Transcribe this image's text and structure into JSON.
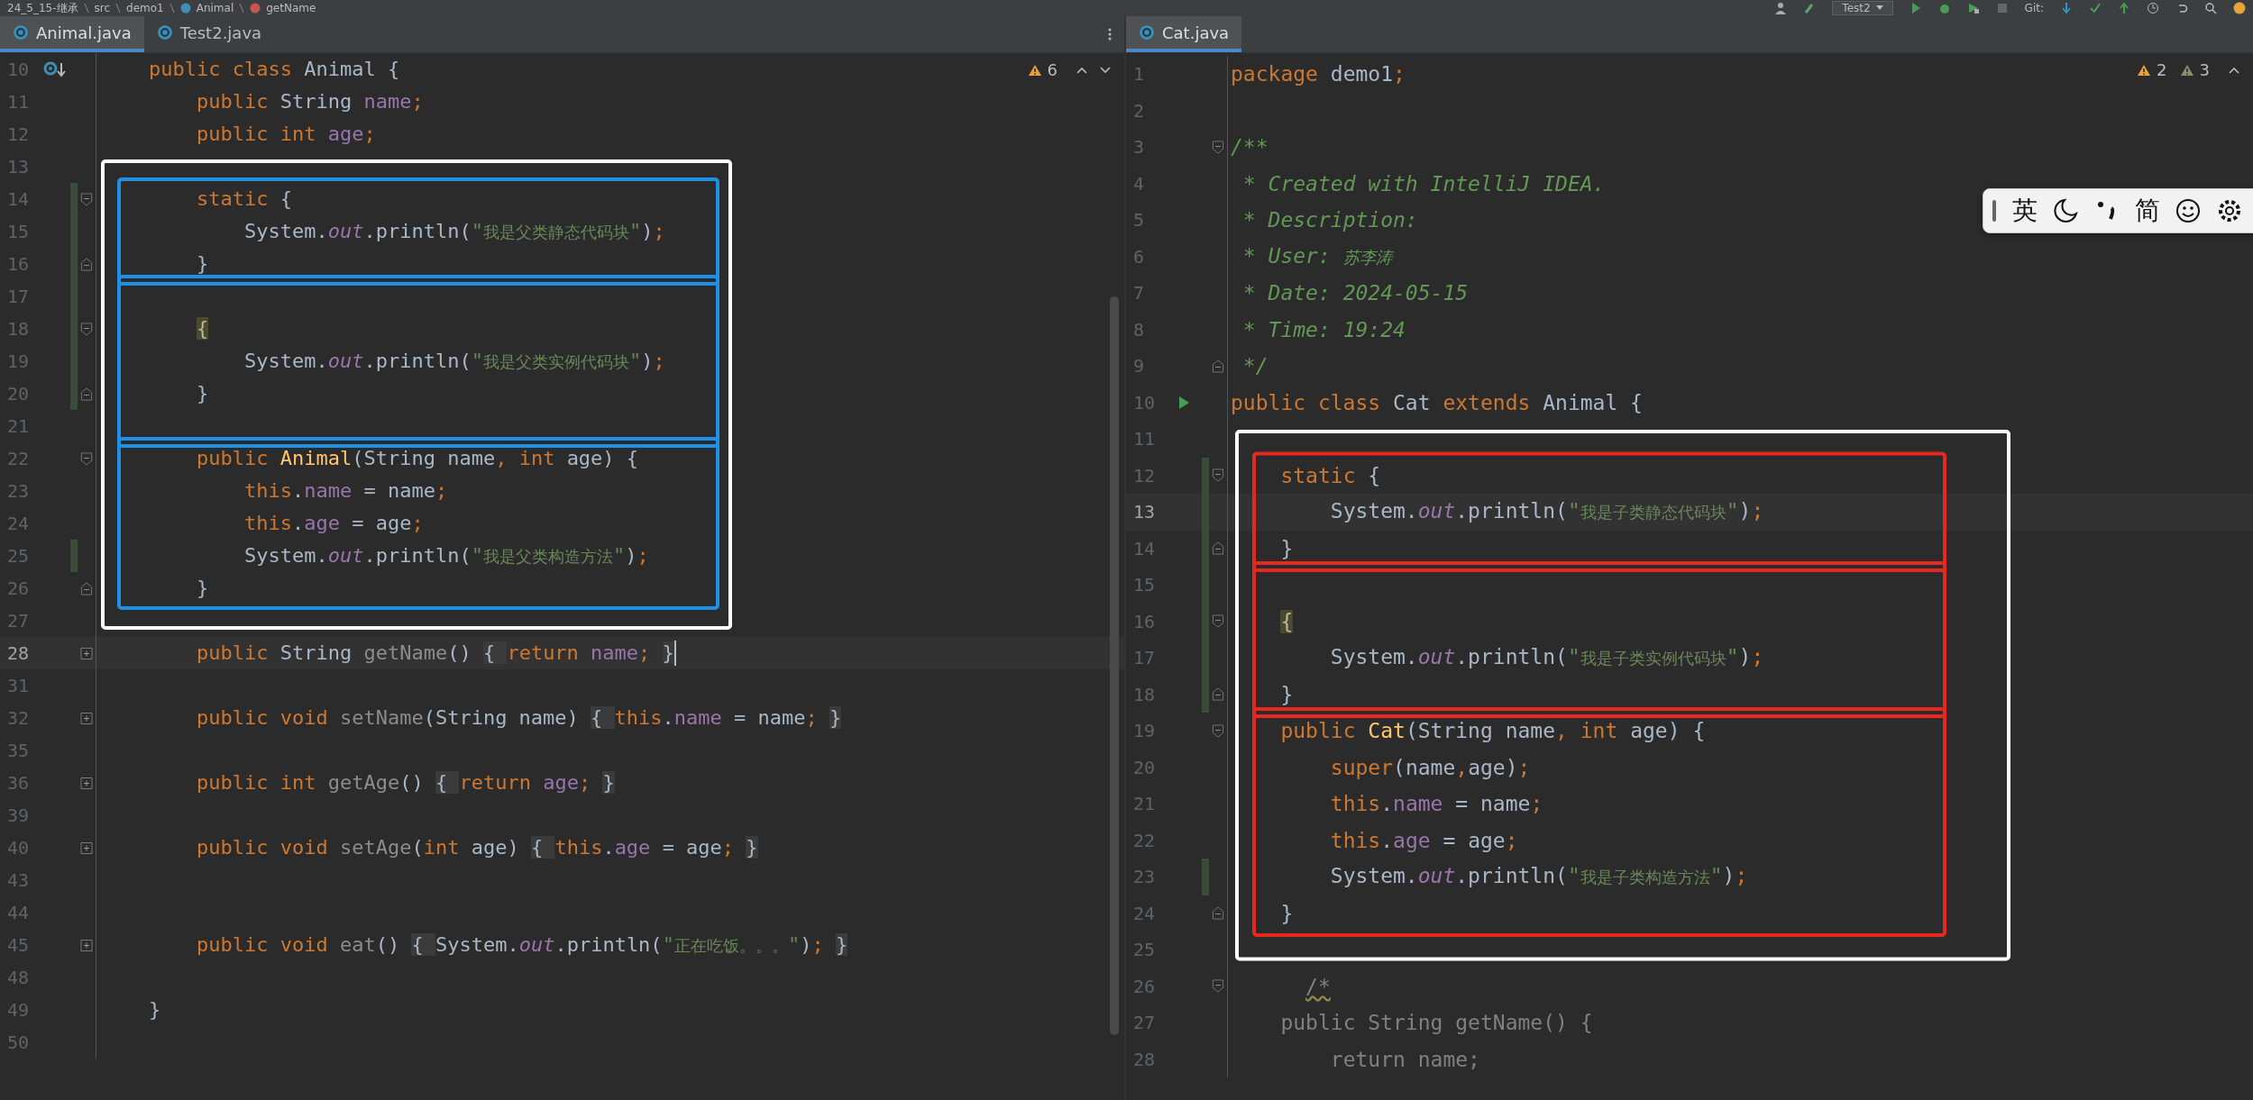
{
  "breadcrumb": [
    {
      "label": "24_5_15-继承",
      "kind": "folder"
    },
    {
      "label": "src",
      "kind": "folder"
    },
    {
      "label": "demo1",
      "kind": "folder"
    },
    {
      "label": "Animal",
      "kind": "class"
    },
    {
      "label": "getName",
      "kind": "method"
    }
  ],
  "toolbar": {
    "run_config": "Test2",
    "vcs_label": "Git:"
  },
  "panes": [
    {
      "tabs": [
        {
          "label": "Animal.java",
          "selected": true
        },
        {
          "label": "Test2.java",
          "selected": false
        }
      ],
      "inspections": [
        {
          "kind": "warning",
          "count": "6"
        }
      ],
      "navigation": [
        {
          "kind": "up"
        },
        {
          "kind": "down"
        }
      ],
      "lines": [
        {
          "number": "10",
          "kind": "override",
          "changed": false,
          "current": false,
          "tokens": [
            {
              "text": "public class ",
              "kind": "kw"
            },
            {
              "text": "Animal {",
              "kind": "plain"
            }
          ]
        },
        {
          "number": "11",
          "kind": "plain",
          "changed": false,
          "current": false,
          "tokens": [
            {
              "text": "    public ",
              "kind": "kw"
            },
            {
              "text": "String ",
              "kind": "plain"
            },
            {
              "text": "name",
              "kind": "field"
            },
            {
              "text": ";",
              "kind": "kw"
            }
          ]
        },
        {
          "number": "12",
          "kind": "plain",
          "changed": false,
          "current": false,
          "tokens": [
            {
              "text": "    public int ",
              "kind": "kw"
            },
            {
              "text": "age",
              "kind": "field"
            },
            {
              "text": ";",
              "kind": "kw"
            }
          ]
        },
        {
          "kind": "frame",
          "color": "#ffffff",
          "children": [
            {
              "number": "13",
              "kind": "plain",
              "changed": false,
              "current": false
            },
            {
              "kind": "frame",
              "color": "#1e90e8",
              "children": [
                {
                  "number": "14",
                  "kind": "fold_start",
                  "changed": true,
                  "current": false,
                  "tokens": [
                    {
                      "text": "    static ",
                      "kind": "kw"
                    },
                    {
                      "text": "{",
                      "kind": "plain"
                    }
                  ]
                },
                {
                  "number": "15",
                  "kind": "plain",
                  "changed": true,
                  "current": false,
                  "tokens": [
                    {
                      "text": "        System.",
                      "kind": "plain"
                    },
                    {
                      "text": "out",
                      "kind": "static"
                    },
                    {
                      "text": ".println(",
                      "kind": "plain"
                    },
                    {
                      "text": "\"我是父类静态代码块\"",
                      "kind": "str"
                    },
                    {
                      "text": ")",
                      "kind": "plain"
                    },
                    {
                      "text": ";",
                      "kind": "kw"
                    }
                  ]
                },
                {
                  "number": "16",
                  "kind": "fold_end",
                  "changed": true,
                  "current": false,
                  "tokens": [
                    {
                      "text": "    }",
                      "kind": "plain"
                    }
                  ]
                }
              ]
            },
            {
              "kind": "frame",
              "color": "#1e90e8",
              "children": [
                {
                  "number": "17",
                  "kind": "plain",
                  "changed": true,
                  "current": false
                },
                {
                  "number": "18",
                  "kind": "fold_start",
                  "changed": true,
                  "current": false,
                  "tokens": [
                    {
                      "text": "    {",
                      "kind": "brace"
                    }
                  ]
                },
                {
                  "number": "19",
                  "kind": "plain",
                  "changed": true,
                  "current": false,
                  "tokens": [
                    {
                      "text": "        System.",
                      "kind": "plain"
                    },
                    {
                      "text": "out",
                      "kind": "static"
                    },
                    {
                      "text": ".println(",
                      "kind": "plain"
                    },
                    {
                      "text": "\"我是父类实例代码块\"",
                      "kind": "str"
                    },
                    {
                      "text": ")",
                      "kind": "plain"
                    },
                    {
                      "text": ";",
                      "kind": "kw"
                    }
                  ]
                },
                {
                  "number": "20",
                  "kind": "fold_end",
                  "changed": true,
                  "current": false,
                  "tokens": [
                    {
                      "text": "    }",
                      "kind": "plain"
                    }
                  ]
                },
                {
                  "number": "21",
                  "kind": "plain",
                  "changed": false,
                  "current": false
                }
              ]
            },
            {
              "kind": "frame",
              "color": "#1e90e8",
              "children": [
                {
                  "number": "22",
                  "kind": "fold_start",
                  "changed": false,
                  "current": false,
                  "tokens": [
                    {
                      "text": "    public ",
                      "kind": "kw"
                    },
                    {
                      "text": "Animal",
                      "kind": "decl"
                    },
                    {
                      "text": "(String name",
                      "kind": "plain"
                    },
                    {
                      "text": ", ",
                      "kind": "kw"
                    },
                    {
                      "text": "int ",
                      "kind": "kw"
                    },
                    {
                      "text": "age) {",
                      "kind": "plain"
                    }
                  ]
                },
                {
                  "number": "23",
                  "kind": "plain",
                  "changed": false,
                  "current": false,
                  "tokens": [
                    {
                      "text": "        this",
                      "kind": "kw"
                    },
                    {
                      "text": ".",
                      "kind": "plain"
                    },
                    {
                      "text": "name",
                      "kind": "field"
                    },
                    {
                      "text": " = name",
                      "kind": "plain"
                    },
                    {
                      "text": ";",
                      "kind": "kw"
                    }
                  ]
                },
                {
                  "number": "24",
                  "kind": "plain",
                  "changed": false,
                  "current": false,
                  "tokens": [
                    {
                      "text": "        this",
                      "kind": "kw"
                    },
                    {
                      "text": ".",
                      "kind": "plain"
                    },
                    {
                      "text": "age",
                      "kind": "field"
                    },
                    {
                      "text": " = age",
                      "kind": "plain"
                    },
                    {
                      "text": ";",
                      "kind": "kw"
                    }
                  ]
                },
                {
                  "number": "25",
                  "kind": "plain",
                  "changed": true,
                  "current": false,
                  "tokens": [
                    {
                      "text": "        System.",
                      "kind": "plain"
                    },
                    {
                      "text": "out",
                      "kind": "static"
                    },
                    {
                      "text": ".println(",
                      "kind": "plain"
                    },
                    {
                      "text": "\"我是父类构造方法\"",
                      "kind": "str"
                    },
                    {
                      "text": ")",
                      "kind": "plain"
                    },
                    {
                      "text": ";",
                      "kind": "kw"
                    }
                  ]
                },
                {
                  "number": "26",
                  "kind": "fold_end",
                  "changed": false,
                  "current": false,
                  "tokens": [
                    {
                      "text": "    }",
                      "kind": "plain"
                    }
                  ]
                }
              ]
            },
            {
              "number": "27",
              "kind": "plain",
              "changed": false,
              "current": false
            }
          ]
        },
        {
          "number": "28",
          "kind": "folded",
          "changed": false,
          "current": true,
          "tokens": [
            {
              "text": "    public ",
              "kind": "kw"
            },
            {
              "text": "String ",
              "kind": "plain"
            },
            {
              "text": "getName",
              "kind": "dim"
            },
            {
              "text": "() ",
              "kind": "plain"
            },
            {
              "text": "{ ",
              "kind": "fold"
            },
            {
              "text": "return ",
              "kind": "kw"
            },
            {
              "text": "name",
              "kind": "field"
            },
            {
              "text": ";",
              "kind": "kw"
            },
            {
              "text": " }",
              "kind": "fold"
            }
          ]
        },
        {
          "number": "31",
          "kind": "plain",
          "changed": false,
          "current": false
        },
        {
          "number": "32",
          "kind": "folded",
          "changed": false,
          "current": false,
          "tokens": [
            {
              "text": "    public void ",
              "kind": "kw"
            },
            {
              "text": "setName",
              "kind": "dim"
            },
            {
              "text": "(String name) ",
              "kind": "plain"
            },
            {
              "text": "{ ",
              "kind": "fold"
            },
            {
              "text": "this",
              "kind": "kw"
            },
            {
              "text": ".",
              "kind": "plain"
            },
            {
              "text": "name",
              "kind": "field"
            },
            {
              "text": " = name",
              "kind": "plain"
            },
            {
              "text": ";",
              "kind": "kw"
            },
            {
              "text": " }",
              "kind": "fold"
            }
          ]
        },
        {
          "number": "35",
          "kind": "plain",
          "changed": false,
          "current": false
        },
        {
          "number": "36",
          "kind": "folded",
          "changed": false,
          "current": false,
          "tokens": [
            {
              "text": "    public int ",
              "kind": "kw"
            },
            {
              "text": "getAge",
              "kind": "dim"
            },
            {
              "text": "() ",
              "kind": "plain"
            },
            {
              "text": "{ ",
              "kind": "fold"
            },
            {
              "text": "return ",
              "kind": "kw"
            },
            {
              "text": "age",
              "kind": "field"
            },
            {
              "text": ";",
              "kind": "kw"
            },
            {
              "text": " }",
              "kind": "fold"
            }
          ]
        },
        {
          "number": "39",
          "kind": "plain",
          "changed": false,
          "current": false
        },
        {
          "number": "40",
          "kind": "folded",
          "changed": false,
          "current": false,
          "tokens": [
            {
              "text": "    public void ",
              "kind": "kw"
            },
            {
              "text": "setAge",
              "kind": "dim"
            },
            {
              "text": "(",
              "kind": "plain"
            },
            {
              "text": "int ",
              "kind": "kw"
            },
            {
              "text": "age) ",
              "kind": "plain"
            },
            {
              "text": "{ ",
              "kind": "fold"
            },
            {
              "text": "this",
              "kind": "kw"
            },
            {
              "text": ".",
              "kind": "plain"
            },
            {
              "text": "age",
              "kind": "field"
            },
            {
              "text": " = age",
              "kind": "plain"
            },
            {
              "text": ";",
              "kind": "kw"
            },
            {
              "text": " }",
              "kind": "fold"
            }
          ]
        },
        {
          "number": "43",
          "kind": "plain",
          "changed": false,
          "current": false
        },
        {
          "number": "44",
          "kind": "plain",
          "changed": false,
          "current": false
        },
        {
          "number": "45",
          "kind": "folded",
          "changed": false,
          "current": false,
          "tokens": [
            {
              "text": "    public void ",
              "kind": "kw"
            },
            {
              "text": "eat",
              "kind": "dim"
            },
            {
              "text": "() ",
              "kind": "plain"
            },
            {
              "text": "{ ",
              "kind": "fold"
            },
            {
              "text": "System.",
              "kind": "plain"
            },
            {
              "text": "out",
              "kind": "static"
            },
            {
              "text": ".println(",
              "kind": "plain"
            },
            {
              "text": "\"正在吃饭。。。\"",
              "kind": "str"
            },
            {
              "text": ")",
              "kind": "plain"
            },
            {
              "text": ";",
              "kind": "kw"
            },
            {
              "text": " }",
              "kind": "fold"
            }
          ]
        },
        {
          "number": "48",
          "kind": "plain",
          "changed": false,
          "current": false
        },
        {
          "number": "49",
          "kind": "plain",
          "changed": false,
          "current": false,
          "tokens": [
            {
              "text": "}",
              "kind": "plain"
            }
          ]
        },
        {
          "number": "50",
          "kind": "plain",
          "changed": false,
          "current": false
        }
      ]
    },
    {
      "tabs": [
        {
          "label": "Cat.java",
          "selected": true
        }
      ],
      "inspections": [
        {
          "kind": "warning",
          "count": "2"
        },
        {
          "kind": "weak",
          "count": "3"
        }
      ],
      "navigation": [
        {
          "kind": "up"
        }
      ],
      "lines": [
        {
          "number": "1",
          "kind": "plain",
          "changed": false,
          "current": false,
          "tokens": [
            {
              "text": "package ",
              "kind": "kw"
            },
            {
              "text": "demo1",
              "kind": "plain"
            },
            {
              "text": ";",
              "kind": "kw"
            }
          ]
        },
        {
          "number": "2",
          "kind": "plain",
          "changed": false,
          "current": false
        },
        {
          "number": "3",
          "kind": "fold_start",
          "changed": false,
          "current": false,
          "tokens": [
            {
              "text": "/**",
              "kind": "doc"
            }
          ]
        },
        {
          "number": "4",
          "kind": "plain",
          "changed": false,
          "current": false,
          "tokens": [
            {
              "text": " * Created with IntelliJ IDEA.",
              "kind": "doc"
            }
          ]
        },
        {
          "number": "5",
          "kind": "plain",
          "changed": false,
          "current": false,
          "tokens": [
            {
              "text": " * Description:",
              "kind": "doc"
            }
          ]
        },
        {
          "number": "6",
          "kind": "plain",
          "changed": false,
          "current": false,
          "tokens": [
            {
              "text": " * User: 苏李涛",
              "kind": "doc"
            }
          ]
        },
        {
          "number": "7",
          "kind": "plain",
          "changed": false,
          "current": false,
          "tokens": [
            {
              "text": " * Date: 2024-05-15",
              "kind": "doc"
            }
          ]
        },
        {
          "number": "8",
          "kind": "plain",
          "changed": false,
          "current": false,
          "tokens": [
            {
              "text": " * Time: 19:24",
              "kind": "doc"
            }
          ]
        },
        {
          "number": "9",
          "kind": "fold_end",
          "changed": false,
          "current": false,
          "tokens": [
            {
              "text": " */",
              "kind": "doc"
            }
          ]
        },
        {
          "number": "10",
          "kind": "run",
          "changed": false,
          "current": false,
          "tokens": [
            {
              "text": "public class ",
              "kind": "kw"
            },
            {
              "text": "Cat ",
              "kind": "plain"
            },
            {
              "text": "extends ",
              "kind": "kw"
            },
            {
              "text": "Animal {",
              "kind": "plain"
            }
          ]
        },
        {
          "kind": "frame",
          "color": "#ffffff",
          "children": [
            {
              "number": "11",
              "kind": "plain",
              "changed": false,
              "current": false
            },
            {
              "kind": "frame",
              "color": "#e8281e",
              "children": [
                {
                  "number": "12",
                  "kind": "fold_start",
                  "changed": true,
                  "current": false,
                  "tokens": [
                    {
                      "text": "    static ",
                      "kind": "kw"
                    },
                    {
                      "text": "{",
                      "kind": "plain"
                    }
                  ]
                },
                {
                  "number": "13",
                  "kind": "plain",
                  "changed": true,
                  "current": true,
                  "tokens": [
                    {
                      "text": "        System.",
                      "kind": "plain"
                    },
                    {
                      "text": "out",
                      "kind": "static"
                    },
                    {
                      "text": ".println(",
                      "kind": "plain"
                    },
                    {
                      "text": "\"我是子类静态代码块\"",
                      "kind": "str"
                    },
                    {
                      "text": ")",
                      "kind": "plain"
                    },
                    {
                      "text": ";",
                      "kind": "kw"
                    }
                  ]
                },
                {
                  "number": "14",
                  "kind": "fold_end",
                  "changed": true,
                  "current": false,
                  "tokens": [
                    {
                      "text": "    }",
                      "kind": "plain"
                    }
                  ]
                }
              ]
            },
            {
              "kind": "frame",
              "color": "#e8281e",
              "children": [
                {
                  "number": "15",
                  "kind": "plain",
                  "changed": true,
                  "current": false
                },
                {
                  "number": "16",
                  "kind": "fold_start",
                  "changed": true,
                  "current": false,
                  "tokens": [
                    {
                      "text": "    {",
                      "kind": "brace"
                    }
                  ]
                },
                {
                  "number": "17",
                  "kind": "plain",
                  "changed": true,
                  "current": false,
                  "tokens": [
                    {
                      "text": "        System.",
                      "kind": "plain"
                    },
                    {
                      "text": "out",
                      "kind": "static"
                    },
                    {
                      "text": ".println(",
                      "kind": "plain"
                    },
                    {
                      "text": "\"我是子类实例代码块\"",
                      "kind": "str"
                    },
                    {
                      "text": ")",
                      "kind": "plain"
                    },
                    {
                      "text": ";",
                      "kind": "kw"
                    }
                  ]
                },
                {
                  "number": "18",
                  "kind": "fold_end",
                  "changed": true,
                  "current": false,
                  "tokens": [
                    {
                      "text": "    }",
                      "kind": "plain"
                    }
                  ]
                }
              ]
            },
            {
              "kind": "frame",
              "color": "#e8281e",
              "children": [
                {
                  "number": "19",
                  "kind": "fold_start",
                  "changed": false,
                  "current": false,
                  "tokens": [
                    {
                      "text": "    public ",
                      "kind": "kw"
                    },
                    {
                      "text": "Cat",
                      "kind": "decl"
                    },
                    {
                      "text": "(String name",
                      "kind": "plain"
                    },
                    {
                      "text": ", ",
                      "kind": "kw"
                    },
                    {
                      "text": "int ",
                      "kind": "kw"
                    },
                    {
                      "text": "age) {",
                      "kind": "plain"
                    }
                  ]
                },
                {
                  "number": "20",
                  "kind": "plain",
                  "changed": false,
                  "current": false,
                  "tokens": [
                    {
                      "text": "        super",
                      "kind": "kw"
                    },
                    {
                      "text": "(name",
                      "kind": "plain"
                    },
                    {
                      "text": ",",
                      "kind": "kw"
                    },
                    {
                      "text": "age)",
                      "kind": "plain"
                    },
                    {
                      "text": ";",
                      "kind": "kw"
                    }
                  ]
                },
                {
                  "number": "21",
                  "kind": "plain",
                  "changed": false,
                  "current": false,
                  "tokens": [
                    {
                      "text": "        this",
                      "kind": "kw"
                    },
                    {
                      "text": ".",
                      "kind": "plain"
                    },
                    {
                      "text": "name",
                      "kind": "field"
                    },
                    {
                      "text": " = name",
                      "kind": "plain"
                    },
                    {
                      "text": ";",
                      "kind": "kw"
                    }
                  ]
                },
                {
                  "number": "22",
                  "kind": "plain",
                  "changed": false,
                  "current": false,
                  "tokens": [
                    {
                      "text": "        this",
                      "kind": "kw"
                    },
                    {
                      "text": ".",
                      "kind": "plain"
                    },
                    {
                      "text": "age",
                      "kind": "field"
                    },
                    {
                      "text": " = age",
                      "kind": "plain"
                    },
                    {
                      "text": ";",
                      "kind": "kw"
                    }
                  ]
                },
                {
                  "number": "23",
                  "kind": "plain",
                  "changed": true,
                  "current": false,
                  "tokens": [
                    {
                      "text": "        System.",
                      "kind": "plain"
                    },
                    {
                      "text": "out",
                      "kind": "static"
                    },
                    {
                      "text": ".println(",
                      "kind": "plain"
                    },
                    {
                      "text": "\"我是子类构造方法\"",
                      "kind": "str"
                    },
                    {
                      "text": ")",
                      "kind": "plain"
                    },
                    {
                      "text": ";",
                      "kind": "kw"
                    }
                  ]
                },
                {
                  "number": "24",
                  "kind": "fold_end",
                  "changed": false,
                  "current": false,
                  "tokens": [
                    {
                      "text": "    }",
                      "kind": "plain"
                    }
                  ]
                }
              ]
            },
            {
              "number": "25",
              "kind": "plain",
              "changed": false,
              "current": false
            }
          ]
        },
        {
          "number": "26",
          "kind": "fold_start",
          "changed": false,
          "current": false,
          "tokens": [
            {
              "text": "      /*",
              "kind": "weak"
            }
          ]
        },
        {
          "number": "27",
          "kind": "plain",
          "changed": false,
          "current": false,
          "tokens": [
            {
              "text": "    public String getName() {",
              "kind": "comment"
            }
          ]
        },
        {
          "number": "28",
          "kind": "plain",
          "changed": false,
          "current": false,
          "tokens": [
            {
              "text": "        return name;",
              "kind": "comment"
            }
          ]
        }
      ]
    }
  ],
  "ime_toolbar": {
    "items": [
      {
        "kind": "text",
        "label": "英"
      },
      {
        "kind": "moon"
      },
      {
        "kind": "punct"
      },
      {
        "kind": "text",
        "label": "简"
      },
      {
        "kind": "smiley"
      },
      {
        "kind": "gear"
      }
    ]
  }
}
